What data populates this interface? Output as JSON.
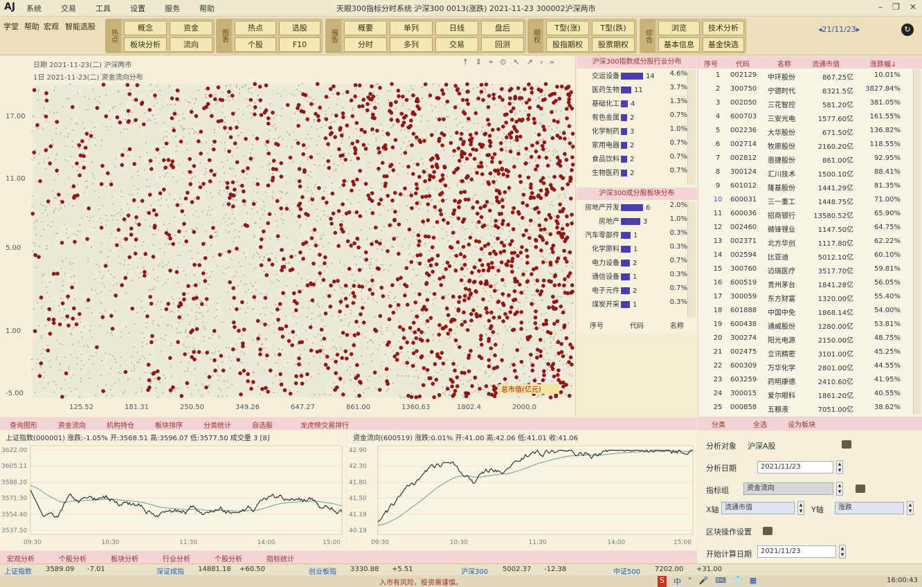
{
  "menubar": {
    "logo": "AJ",
    "items": [
      "系统",
      "交易",
      "工具",
      "设置",
      "服务",
      "帮助"
    ],
    "title": "天眼300指标分时系统  沪深300 0013(涨跌)  2021-11-23  300002沪深两市",
    "controls": [
      "–",
      "❐",
      "✕"
    ]
  },
  "toolbar": {
    "left_buttons": [
      "学堂",
      "帮助",
      "宏观",
      "智能选股"
    ],
    "groups": [
      {
        "label": "热点",
        "buttons": [
          "概念",
          "资金",
          "板块分析",
          "流向"
        ]
      },
      {
        "label": "图表",
        "buttons": [
          "热点",
          "选股",
          "个股",
          "F10"
        ]
      },
      {
        "label": "报告",
        "buttons": [
          "概要",
          "单列",
          "日线",
          "盘后",
          "分时",
          "多列",
          "交易",
          "回测"
        ]
      },
      {
        "label": "期权",
        "buttons": [
          "T型(涨)",
          "T型(跌)",
          "股指期权",
          "股票期权"
        ]
      },
      {
        "label": "综合",
        "buttons": [
          "浏览",
          "技术分析",
          "基本信息",
          "基金快选"
        ]
      }
    ],
    "date": "◂21/11/23▸",
    "refresh": "↻"
  },
  "scatter": {
    "info_line1": "日期  2021-11-23(二)   沪深两市",
    "info_line2": "1日  2021-11-23(二)   资金流向分布",
    "tools": [
      "↑",
      "⇕",
      "⌖",
      "⊙",
      "↖",
      "↗",
      "›",
      "»"
    ],
    "y_ticks": [
      "17.00",
      "11.00",
      "5.00",
      "1.00",
      "-5.00"
    ],
    "x_ticks": [
      "125.52",
      "181.31",
      "250.50",
      "349.26",
      "647.27",
      "861.00",
      "1360.63",
      "1802.4",
      "2000.0"
    ],
    "corner_label": "总市值(亿元)",
    "dot_color": "#9e1414",
    "bg_dot_color": "#b9b4a0"
  },
  "industry": {
    "header1": "沪深300指数成分股行业分布",
    "rows1": [
      {
        "name": "交运设备",
        "count": "14",
        "pct": "4.6%",
        "w": 1.0
      },
      {
        "name": "医药生物",
        "count": "11",
        "pct": "3.7%",
        "w": 0.35
      },
      {
        "name": "基础化工",
        "count": "4",
        "pct": "1.3%",
        "w": 0.15
      },
      {
        "name": "有色金属",
        "count": "2",
        "pct": "0.7%",
        "w": 0.1
      },
      {
        "name": "化学制药",
        "count": "3",
        "pct": "1.0%",
        "w": 0.12
      },
      {
        "name": "家用电器",
        "count": "2",
        "pct": "0.7%",
        "w": 0.1
      },
      {
        "name": "食品饮料",
        "count": "2",
        "pct": "0.7%",
        "w": 0.1
      },
      {
        "name": "生物医药",
        "count": "2",
        "pct": "0.7%",
        "w": 0.1
      }
    ],
    "header2": "沪深300成分股板块分布",
    "rows2": [
      {
        "name": "房地产开发",
        "count": "6",
        "pct": "2.0%",
        "w": 1.0
      },
      {
        "name": "房地产",
        "count": "3",
        "pct": "1.0%",
        "w": 0.85
      },
      {
        "name": "汽车零部件",
        "count": "1",
        "pct": "0.3%",
        "w": 0.3
      },
      {
        "name": "化学原料",
        "count": "1",
        "pct": "0.3%",
        "w": 0.3
      },
      {
        "name": "电力设备",
        "count": "2",
        "pct": "0.7%",
        "w": 0.25
      },
      {
        "name": "通信设备",
        "count": "1",
        "pct": "0.3%",
        "w": 0.25
      },
      {
        "name": "电子元件",
        "count": "2",
        "pct": "0.7%",
        "w": 0.25
      },
      {
        "name": "煤炭开采",
        "count": "1",
        "pct": "0.3%",
        "w": 0.25
      }
    ],
    "footer": [
      "序号",
      "代码",
      "名称"
    ]
  },
  "stocklist": {
    "headers": [
      "序号",
      "代码",
      "名称",
      "流通市值",
      "涨跌幅↓"
    ],
    "rows": [
      [
        "1",
        "002129",
        "中环股份",
        "867.25亿",
        "10.01%"
      ],
      [
        "2",
        "300750",
        "宁德时代",
        "8321.5亿",
        "3827.84%"
      ],
      [
        "3",
        "002050",
        "三花智控",
        "581.20亿",
        "381.05%"
      ],
      [
        "4",
        "600703",
        "三安光电",
        "1577.60亿",
        "161.55%"
      ],
      [
        "5",
        "002236",
        "大华股份",
        "671.50亿",
        "136.82%"
      ],
      [
        "6",
        "002714",
        "牧原股份",
        "2160.20亿",
        "118.55%"
      ],
      [
        "7",
        "002812",
        "恩捷股份",
        "861.00亿",
        "92.95%"
      ],
      [
        "8",
        "300124",
        "汇川技术",
        "1500.10亿",
        "88.41%"
      ],
      [
        "9",
        "601012",
        "隆基股份",
        "1441.29亿",
        "81.35%"
      ],
      [
        "10",
        "600031",
        "三一重工",
        "1448.75亿",
        "71.00%"
      ],
      [
        "11",
        "600036",
        "招商银行",
        "13580.52亿",
        "65.90%"
      ],
      [
        "12",
        "002460",
        "赣锋锂业",
        "1147.50亿",
        "64.75%"
      ],
      [
        "13",
        "002371",
        "北方华创",
        "1117.80亿",
        "62.22%"
      ],
      [
        "14",
        "002594",
        "比亚迪",
        "5012.10亿",
        "60.10%"
      ],
      [
        "15",
        "300760",
        "迈瑞医疗",
        "3517.70亿",
        "59.81%"
      ],
      [
        "16",
        "600519",
        "贵州茅台",
        "1841.28亿",
        "56.05%"
      ],
      [
        "17",
        "300059",
        "东方财富",
        "1320.00亿",
        "55.40%"
      ],
      [
        "18",
        "601888",
        "中国中免",
        "1868.14亿",
        "54.00%"
      ],
      [
        "19",
        "600438",
        "通威股份",
        "1280.00亿",
        "53.81%"
      ],
      [
        "20",
        "300274",
        "阳光电源",
        "2150.00亿",
        "48.75%"
      ],
      [
        "21",
        "002475",
        "立讯精密",
        "3101.00亿",
        "45.25%"
      ],
      [
        "22",
        "600309",
        "万华化学",
        "2801.00亿",
        "44.55%"
      ],
      [
        "23",
        "603259",
        "药明康德",
        "2410.60亿",
        "41.95%"
      ],
      [
        "24",
        "300015",
        "爱尔眼科",
        "1861.20亿",
        "40.55%"
      ],
      [
        "25",
        "000858",
        "五粮液",
        "7051.00亿",
        "38.62%"
      ]
    ],
    "tabs": [
      "分类",
      "全选",
      "设为板块"
    ]
  },
  "form": {
    "target_label": "分析对象",
    "target_value": "沪深A股",
    "date_label": "分析日期",
    "date_value": "2021/11/23",
    "indicator_label": "指标组",
    "indicator_value": "资金流向",
    "x_label": "X轴",
    "x_value": "流通市值",
    "y_label": "Y轴",
    "y_value": "涨跌",
    "section_label": "区块操作设置",
    "start_label": "开始计算日期",
    "start_value": "2021/11/23"
  },
  "bottom_tabs": [
    "查询图形",
    "资金流向",
    "机构持仓",
    "板块排序",
    "分类统计",
    "自选股",
    "龙虎榜交易排行"
  ],
  "mini1": {
    "title": "上证指数(000001)  涨跌:-1.05% 开:3568.51 高:3596.07 低:3577.50 成交量 3  [8]",
    "yticks": [
      "3622.00",
      "3605.11",
      "3588.20",
      "3571.30",
      "3554.40",
      "3537.50"
    ],
    "xticks": [
      "09:30",
      "10:30",
      "11:30",
      "14:00",
      "15:00"
    ]
  },
  "mini2": {
    "title": "资金流向(600519)  涨跌:0.01% 开:41.00 高:42.06 低:41.01 收:41.06",
    "yticks": [
      "42.90",
      "42.30",
      "41.80",
      "41.50",
      "41.19",
      "40.19"
    ],
    "xticks": [
      "09:30",
      "10:30",
      "11:30",
      "14:00",
      "15:00"
    ]
  },
  "bottom2_tabs": [
    "宏观分析",
    "个股分析",
    "板块分析",
    "行业分析",
    "个股分析",
    "指标统计"
  ],
  "ticker": [
    {
      "name": "上证指数",
      "val": "3589.09",
      "chg": "-7.01",
      "c": "#1a60c0"
    },
    {
      "name": "深证成指",
      "val": "14881.18",
      "chg": "+60.50",
      "c": "#1a60c0"
    },
    {
      "name": "创业板指",
      "val": "3330.88",
      "chg": "+5.51",
      "c": "#1a60c0"
    },
    {
      "name": "沪深300",
      "val": "5002.37",
      "chg": "-12.38",
      "c": "#1a60c0"
    },
    {
      "name": "中证500",
      "val": "7202.00",
      "chg": "+31.00",
      "c": "#1a60c0"
    }
  ],
  "status": {
    "notice": "入市有风险，投资需谨慎。",
    "time": "16:00:43",
    "ime": [
      "S",
      "中",
      "°",
      "🎤",
      "⌨",
      "👕",
      "▦"
    ]
  }
}
